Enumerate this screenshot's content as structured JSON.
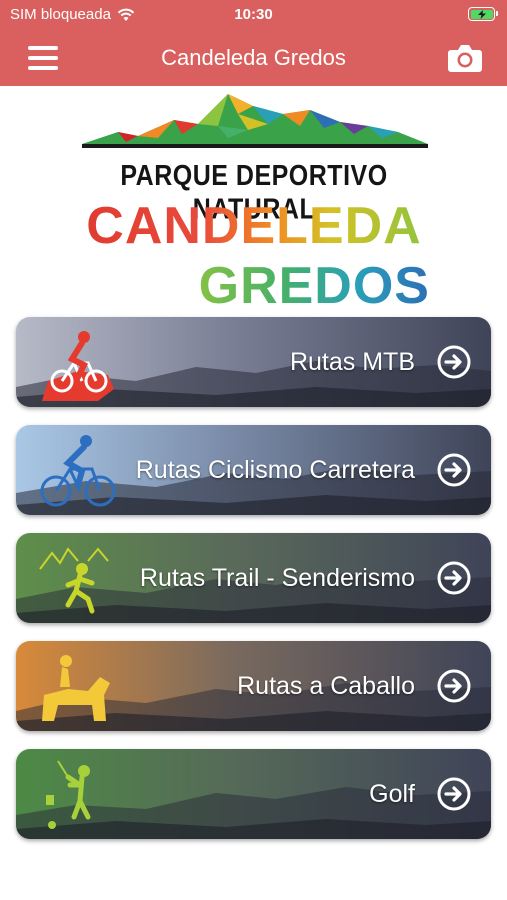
{
  "status_bar": {
    "carrier": "SIM bloqueada",
    "time": "10:30"
  },
  "nav": {
    "title": "Candeleda Gredos",
    "menu_icon": "hamburger-menu-icon",
    "camera_icon": "camera-icon"
  },
  "logo": {
    "subtitle": "PARQUE DEPORTIVO NATURAL",
    "name_line1": "CANDELEDA",
    "name_line2": "GREDOS"
  },
  "menu": [
    {
      "label": "Rutas MTB",
      "icon": "mountain-bike-icon",
      "color": "#e53b2e"
    },
    {
      "label": "Rutas Ciclismo Carretera",
      "icon": "road-cycling-icon",
      "color": "#2c6fc0"
    },
    {
      "label": "Rutas Trail - Senderismo",
      "icon": "trail-runner-icon",
      "color": "#c8d62b"
    },
    {
      "label": "Rutas a Caballo",
      "icon": "horse-rider-icon",
      "color": "#f3c93a"
    },
    {
      "label": "Golf",
      "icon": "golfer-icon",
      "color": "#a6d13a"
    }
  ],
  "colors": {
    "header": "#d9605e",
    "battery": "#4cd964"
  }
}
